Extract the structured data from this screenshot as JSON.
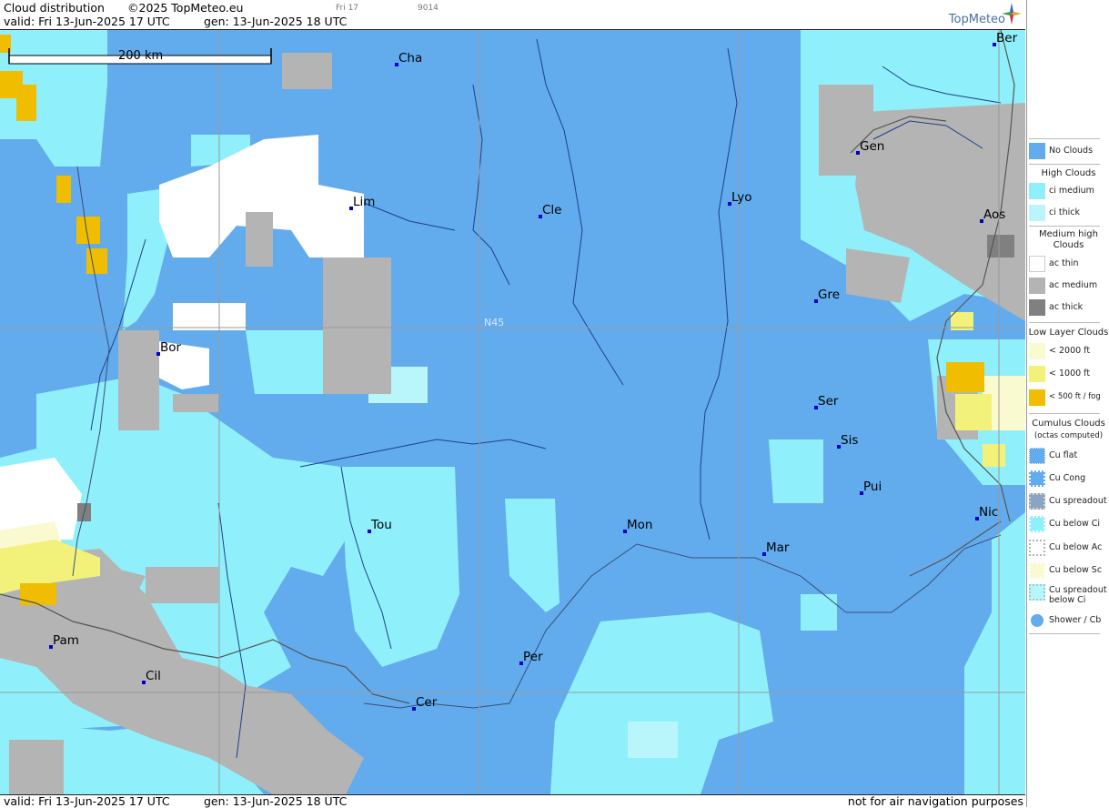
{
  "header": {
    "title": "Cloud distribution",
    "copyright": "©2025 TopMeteo.eu",
    "day": "Fri 17",
    "code": "9014",
    "valid": "valid:  Fri  13-Jun-2025  17 UTC",
    "generated": "gen: 13-Jun-2025 18 UTC",
    "logo": "TopMeteo"
  },
  "footer": {
    "valid": "valid:  Fri  13-Jun-2025  17 UTC",
    "generated": "gen: 13-Jun-2025 18 UTC",
    "disclaimer": "not for air navigation purposes"
  },
  "map": {
    "scale_label": "200 km",
    "latitude_label": "N45",
    "colors": {
      "no_clouds": "#62acee",
      "ci_medium": "#8ff0fb",
      "ci_thick": "#b8f6fb",
      "ac_thin": "#ffffff",
      "ac_medium": "#b4b4b4",
      "ac_thick": "#808080",
      "low_2000": "#fafad0",
      "low_1000": "#f2f27a",
      "low_500": "#f0bd00"
    },
    "cities": [
      {
        "name": "Cha"
      },
      {
        "name": "Ber"
      },
      {
        "name": "Gen"
      },
      {
        "name": "Lim"
      },
      {
        "name": "Cle"
      },
      {
        "name": "Lyo"
      },
      {
        "name": "Aos"
      },
      {
        "name": "Gre"
      },
      {
        "name": "Bor"
      },
      {
        "name": "Ser"
      },
      {
        "name": "Sis"
      },
      {
        "name": "Pui"
      },
      {
        "name": "Tou"
      },
      {
        "name": "Mon"
      },
      {
        "name": "Mar"
      },
      {
        "name": "Nic"
      },
      {
        "name": "Pam"
      },
      {
        "name": "Cil"
      },
      {
        "name": "Per"
      },
      {
        "name": "Cer"
      }
    ]
  },
  "legend": {
    "no_clouds": "No Clouds",
    "high_clouds": "High Clouds",
    "ci_medium": "ci medium",
    "ci_thick": "ci thick",
    "medium_high": "Medium high Clouds",
    "ac_thin": "ac thin",
    "ac_medium": "ac medium",
    "ac_thick": "ac thick",
    "low_layer": "Low Layer Clouds",
    "low_2000": "< 2000 ft",
    "low_1000": "< 1000 ft",
    "low_500": "< 500 ft / fog",
    "cumulus": "Cumulus Clouds",
    "cumulus_note": "(octas computed)",
    "cu_flat": "Cu flat",
    "cu_cong": "Cu Cong",
    "cu_spreadout": "Cu spreadout",
    "cu_below_ci": "Cu below Ci",
    "cu_below_ac": "Cu below Ac",
    "cu_below_sc": "Cu below Sc",
    "cu_spreadout_below_ci": "Cu spreadout below Ci",
    "shower_cb": "Shower / Cb"
  }
}
